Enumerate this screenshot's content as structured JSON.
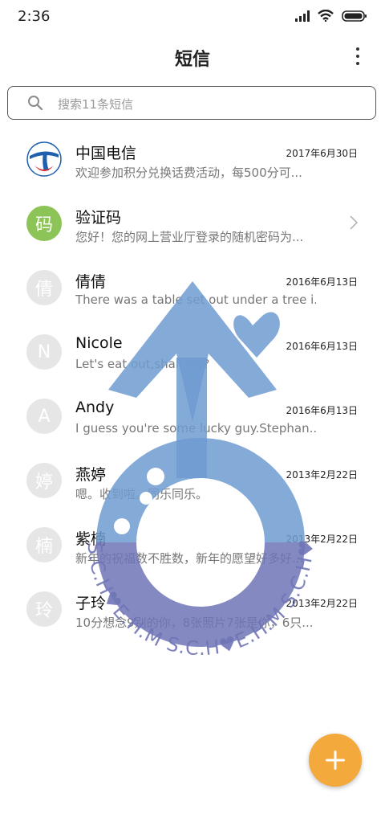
{
  "status_bar": {
    "time": "2:36"
  },
  "header": {
    "title": "短信"
  },
  "search": {
    "placeholder": "搜索11条短信"
  },
  "conversations": [
    {
      "name": "中国电信",
      "avatar": "telecom-logo",
      "preview": "欢迎参加积分兑换话费活动，每500分可...",
      "date": "2017年6月30日"
    },
    {
      "name": "验证码",
      "avatar": "码",
      "preview": "您好！您的网上营业厅登录的随机密码为...",
      "date": ""
    },
    {
      "name": "倩倩",
      "avatar": "倩",
      "preview": "There was a table set out under a tree i...",
      "date": "2016年6月13日"
    },
    {
      "name": "Nicole",
      "avatar": "N",
      "preview": "Let's eat out,shall we?",
      "date": "2016年6月13日"
    },
    {
      "name": "Andy",
      "avatar": "A",
      "preview": "I guess you're some lucky guy.Stephan...",
      "date": "2016年6月13日"
    },
    {
      "name": "燕婷",
      "avatar": "婷",
      "preview": "嗯。收到啦。同乐同乐。",
      "date": "2013年2月22日"
    },
    {
      "name": "紫楠",
      "avatar": "楠",
      "preview": "新年的祝福数不胜数，新年的愿望好多好...",
      "date": "2013年2月22日"
    },
    {
      "name": "子玲",
      "avatar": "玲",
      "preview": "10分想念9别的你，8张照片7张是你，6只...",
      "date": "2013年2月22日"
    }
  ],
  "watermark": {
    "text": "S.C.H♥E.H.M S.C.H♥E.H.M S.C.H♥E"
  },
  "colors": {
    "accent": "#f3a93b",
    "green_avatar": "#8dc457",
    "grey_avatar": "#e6e6e6",
    "telecom_blue": "#1f5fae",
    "watermark_blue": "#6f9bd1",
    "watermark_purple": "#6f74b6"
  }
}
